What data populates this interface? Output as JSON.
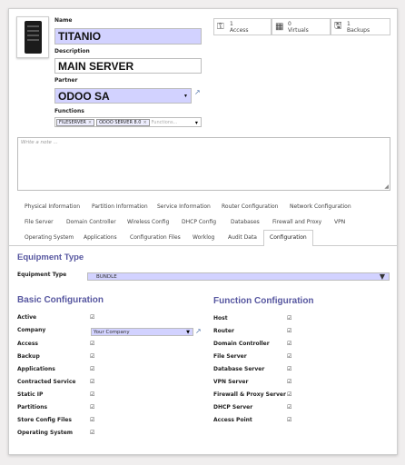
{
  "header": {
    "name_label": "Name",
    "name_value": "TITANIO",
    "description_label": "Description",
    "description_value": "MAIN SERVER",
    "partner_label": "Partner",
    "partner_value": "ODOO SA",
    "functions_label": "Functions",
    "function_tags": [
      "FILESERVER",
      "ODOO SERVER 8.0"
    ],
    "functions_placeholder": "Functions..."
  },
  "stats": [
    {
      "icon": "key-icon",
      "count": "1",
      "label": "Access"
    },
    {
      "icon": "grid-icon",
      "count": "0",
      "label": "Virtuals"
    },
    {
      "icon": "floppy-icon",
      "count": "1",
      "label": "Backups"
    }
  ],
  "note_placeholder": "Write a note ...",
  "tabs": {
    "row1": [
      "Physical Information",
      "Partition Information",
      "Service Information",
      "Router Configuration",
      "Network Configuration"
    ],
    "row2": [
      "File Server",
      "Domain Controller",
      "Wireless Config",
      "DHCP Config",
      "Databases",
      "Firewall and Proxy",
      "VPN"
    ],
    "row3": [
      "Operating System",
      "Applications",
      "Configuration Files",
      "Worklog",
      "Audit Data",
      "Configuration"
    ],
    "active": "Configuration"
  },
  "equipment": {
    "title": "Equipment Type",
    "type_label": "Equipment Type",
    "type_value": "BUNDLE"
  },
  "basic": {
    "title": "Basic Configuration",
    "company_value": "Your Company",
    "rows": [
      {
        "label": "Active",
        "checked": true
      },
      {
        "label": "Company",
        "checked": false
      },
      {
        "label": "Access",
        "checked": true
      },
      {
        "label": "Backup",
        "checked": true
      },
      {
        "label": "Applications",
        "checked": true
      },
      {
        "label": "Contracted Service",
        "checked": true
      },
      {
        "label": "Static IP",
        "checked": true
      },
      {
        "label": "Partitions",
        "checked": true
      },
      {
        "label": "Store Config Files",
        "checked": true
      },
      {
        "label": "Operating System",
        "checked": true
      }
    ]
  },
  "function_config": {
    "title": "Function Configuration",
    "rows": [
      {
        "label": "Host",
        "checked": true
      },
      {
        "label": "Router",
        "checked": true
      },
      {
        "label": "Domain Controller",
        "checked": true
      },
      {
        "label": "File Server",
        "checked": true
      },
      {
        "label": "Database Server",
        "checked": true
      },
      {
        "label": "VPN Server",
        "checked": true
      },
      {
        "label": "Firewall & Proxy Server",
        "checked": true
      },
      {
        "label": "DHCP Server",
        "checked": true
      },
      {
        "label": "Access Point",
        "checked": true
      }
    ]
  },
  "colors": {
    "required_field": "#d2d2ff",
    "section_title": "#5757a0",
    "link": "#5a7cae"
  }
}
